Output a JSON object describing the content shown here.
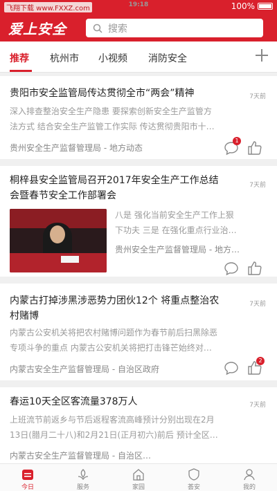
{
  "status": {
    "left_label": "飞翔下载  www.FXXZ.com",
    "time": "19:18",
    "battery": "100%"
  },
  "app": {
    "logo": "爱上安全",
    "search_placeholder": "搜索"
  },
  "tabs": [
    "推荐",
    "杭州市",
    "小视频",
    "消防安全"
  ],
  "articles": [
    {
      "title": "贵阳市安全监管局传达贯彻全市“两会”精神",
      "time": "7天前",
      "summary_line1": "深入排查整治安全生产隐患 要探索创新安全生产监管方",
      "summary_line2": "法方式 结合安全生产监管工作实际 传达贯彻贵阳市十…",
      "source": "贵州安全生产监督管理局 - 地方动态",
      "comment_badge": "1"
    },
    {
      "title_line1": "桐梓县安全监管局召开2017年安全生产工作总结",
      "title_line2": "会暨春节安全工作部署会",
      "time": "7天前",
      "summary_line1": "八是 强化当前安全生产工作上狠",
      "summary_line2": "下功夫 三是 在强化重点行业治…",
      "source": "贵州安全生产监督管理局 - 地方…"
    },
    {
      "title_line1": "内蒙古打掉涉黑涉恶势力团伙12个 将重点整治农",
      "title_line2": "村赌博",
      "time": "7天前",
      "summary_line1": "内蒙古公安机关将把农村赌博问题作为春节前后扫黑除恶",
      "summary_line2": "专项斗争的重点 内蒙古公安机关将把打击锋芒始终对…",
      "source": "内蒙古安全生产监督管理局 - 自治区政府",
      "like_badge": "2"
    },
    {
      "title": "春运10天全区客流量378万人",
      "time": "7天前",
      "summary_line1": "上班流节前返乡与节后返程客流高峰预计分别出现在2月",
      "summary_line2": "13日(腊月二十八)和2月21日(正月初六)前后 预计全区…",
      "source": "内蒙古安全生产监督管理局 - 自治区…"
    }
  ],
  "bottom_nav": [
    "今日",
    "服务",
    "家园",
    "荟安",
    "我的"
  ],
  "colors": {
    "accent": "#d9202c"
  }
}
